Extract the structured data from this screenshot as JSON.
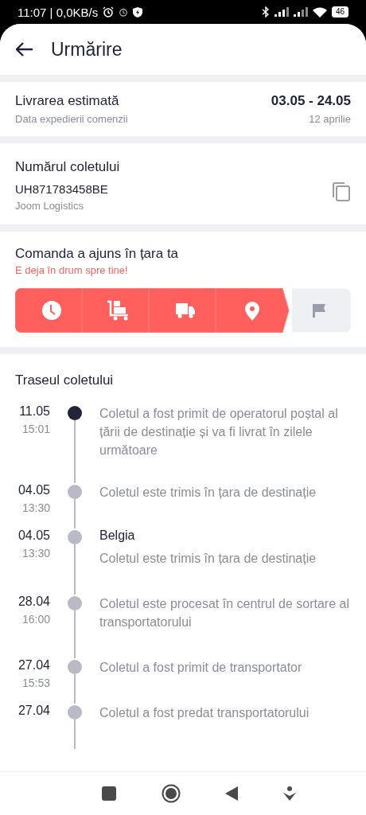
{
  "status_bar": {
    "time": "11:07 | 0,0KB/s",
    "battery": "46"
  },
  "header": {
    "title": "Urmărire"
  },
  "delivery": {
    "label": "Livrarea estimată",
    "sublabel": "Data expedierii comenzii",
    "range": "03.05 - 24.05",
    "date": "12 aprilie"
  },
  "parcel": {
    "label": "Numărul coletului",
    "number": "UH871783458BE",
    "carrier": "Joom Logistics"
  },
  "status": {
    "title": "Comanda a ajuns în țara ta",
    "subtitle": "E deja în drum spre tine!",
    "steps": [
      {
        "kind": "clock",
        "done": true
      },
      {
        "kind": "cart",
        "done": true
      },
      {
        "kind": "truck",
        "done": true
      },
      {
        "kind": "pin",
        "done": true
      },
      {
        "kind": "flag",
        "done": false
      }
    ]
  },
  "route": {
    "title": "Traseul coletului",
    "events": [
      {
        "date": "11.05",
        "time": "15:01",
        "text": "Coletul a fost primit de operatorul poștal al țării de destinație și va fi livrat în zilele următoare",
        "current": true
      },
      {
        "date": "04.05",
        "time": "13:30",
        "text": "Coletul este trimis în țara de destinație",
        "current": false
      },
      {
        "date": "04.05",
        "time": "13:30",
        "location": "Belgia",
        "text": "Coletul este trimis în țara de destinație",
        "current": false
      },
      {
        "date": "28.04",
        "time": "16:00",
        "text": "Coletul este procesat în centrul de sortare al transportatorului",
        "current": false
      },
      {
        "date": "27.04",
        "time": "15:53",
        "text": "Coletul a fost primit de transportator",
        "current": false
      },
      {
        "date": "27.04",
        "text": "Coletul a fost predat transportatorului",
        "current": false
      }
    ]
  }
}
